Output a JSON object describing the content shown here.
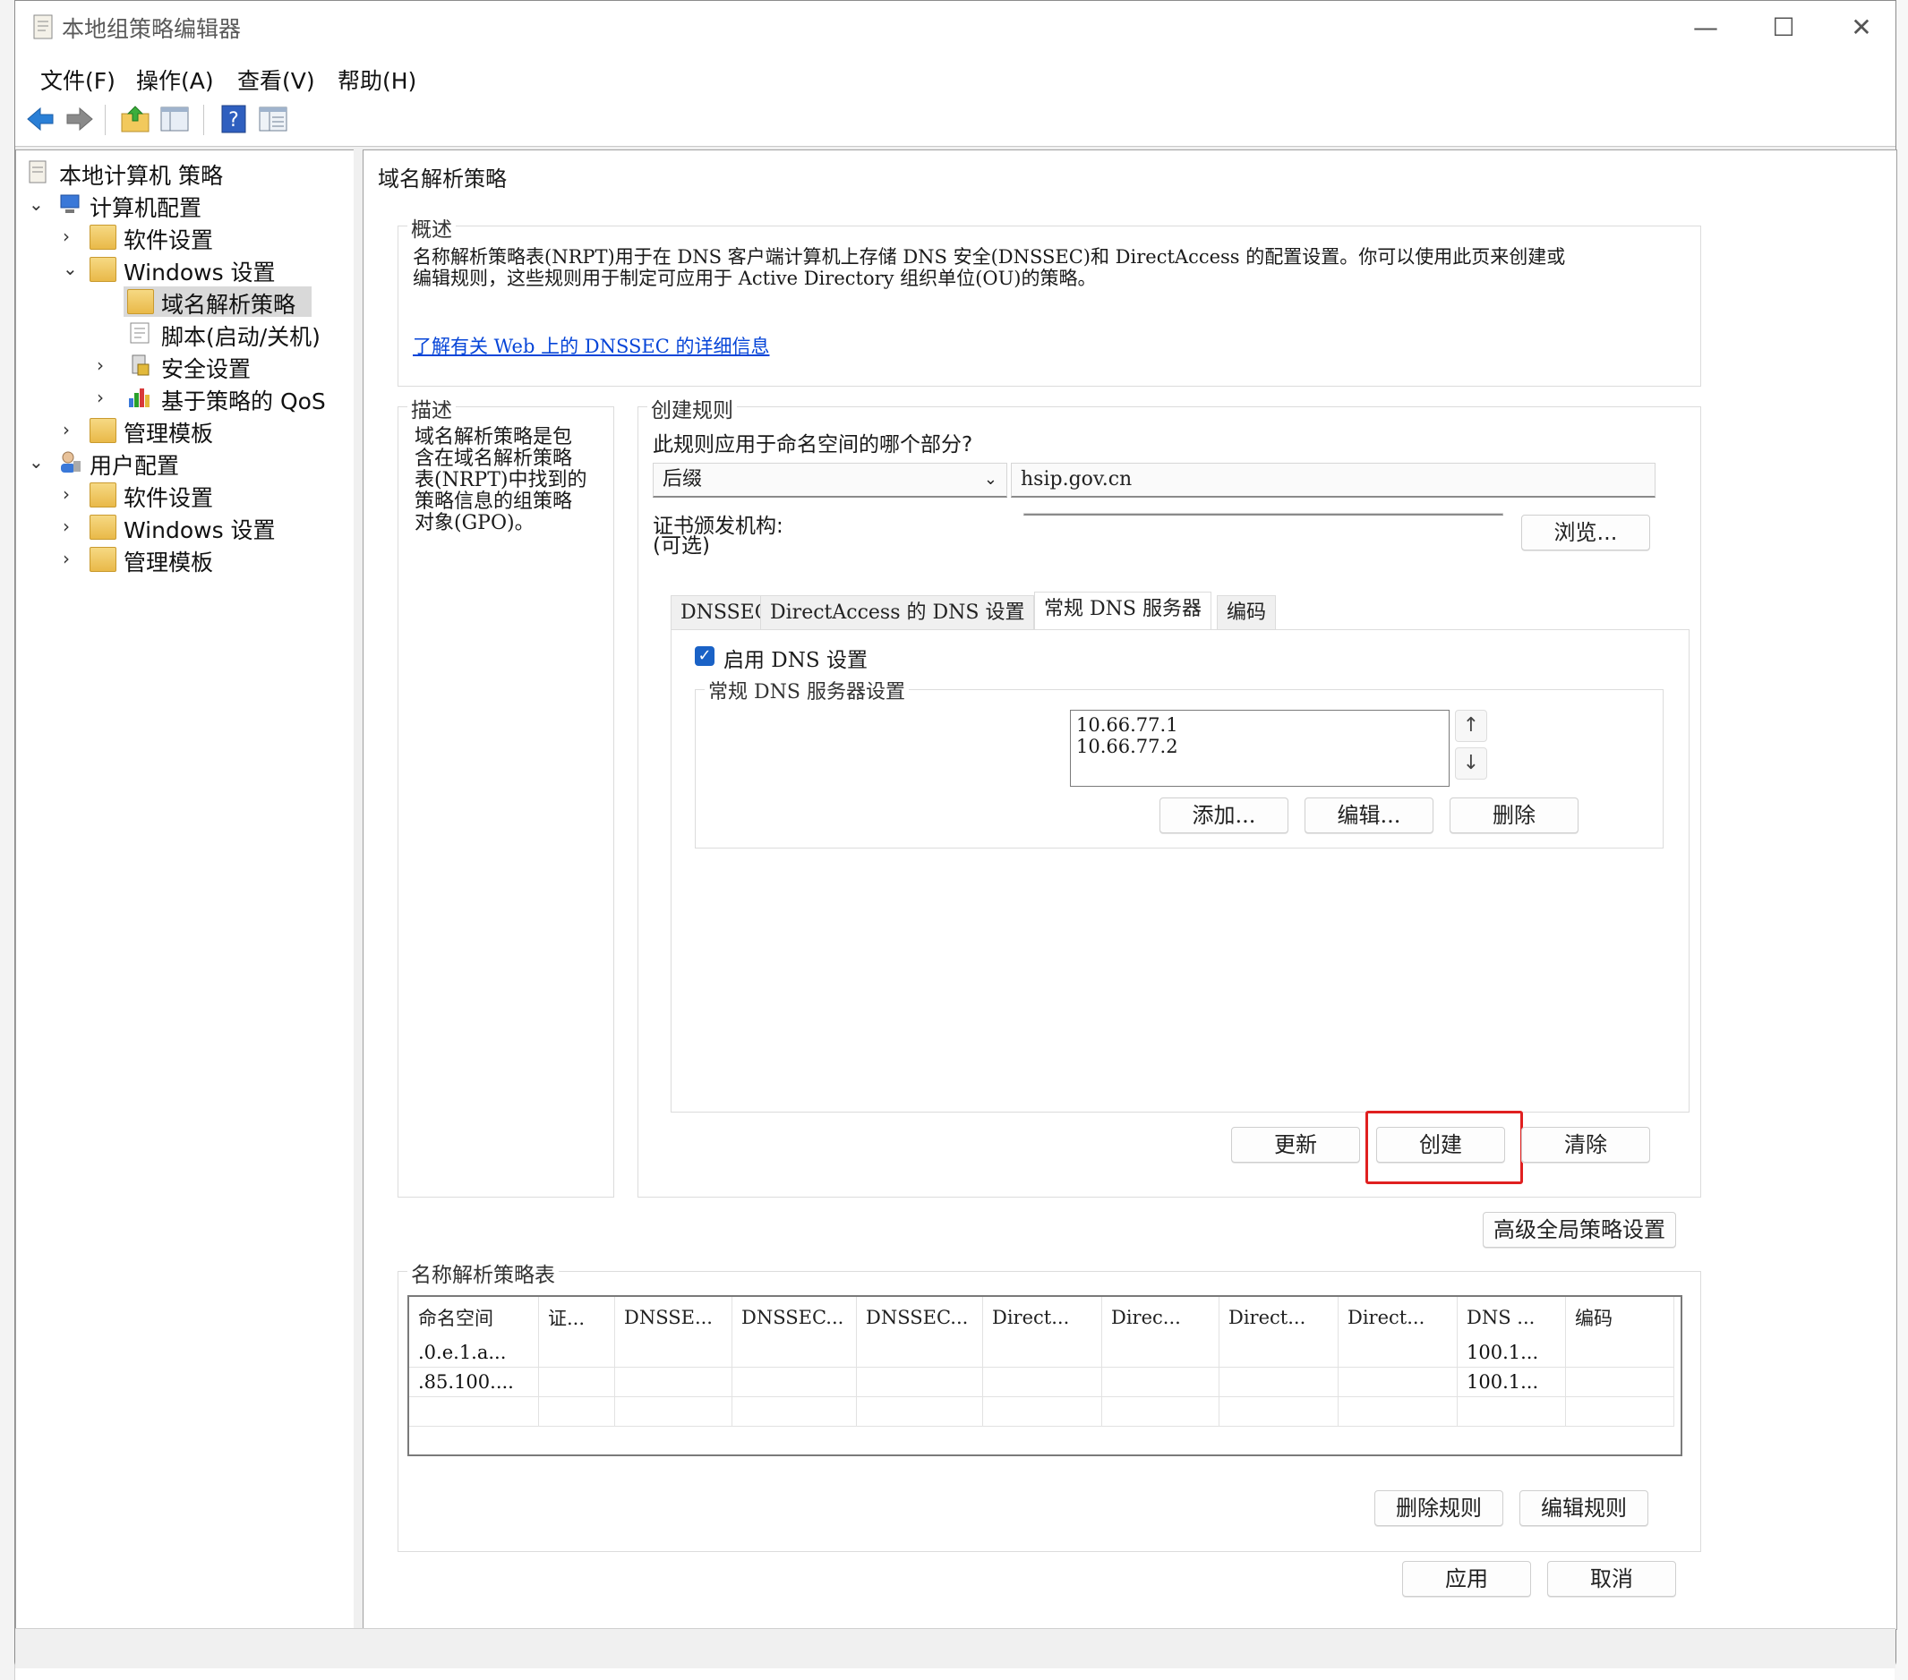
{
  "window": {
    "title": "本地组策略编辑器",
    "min_icon": "minimize-icon",
    "max_icon": "maximize-icon",
    "close_icon": "close-icon"
  },
  "menu": [
    "文件(F)",
    "操作(A)",
    "查看(V)",
    "帮助(H)"
  ],
  "toolbar": {
    "icons": [
      "back-arrow-icon",
      "forward-arrow-icon",
      "up-folder-icon",
      "show-hide-tree-icon",
      "help-icon",
      "properties-view-icon"
    ]
  },
  "tree": {
    "root": "本地计算机 策略",
    "computer": "计算机配置",
    "c_software": "软件设置",
    "c_windows": "Windows 设置",
    "nrp": "域名解析策略",
    "scripts": "脚本(启动/关机)",
    "security": "安全设置",
    "qos": "基于策略的 QoS",
    "c_admin": "管理模板",
    "user": "用户配置",
    "u_software": "软件设置",
    "u_windows": "Windows 设置",
    "u_admin": "管理模板"
  },
  "page": {
    "heading": "域名解析策略",
    "overview": {
      "legend": "概述",
      "line1": "名称解析策略表(NRPT)用于在 DNS 客户端计算机上存储 DNS 安全(DNSSEC)和 DirectAccess 的配置设置。你可以使用此页来创建或",
      "line2": "编辑规则，这些规则用于制定可应用于 Active Directory 组织单位(OU)的策略。",
      "link": "了解有关 Web 上的 DNSSEC 的详细信息"
    },
    "description": {
      "legend": "描述",
      "lines": [
        "域名解析策略是包",
        "含在域名解析策略",
        "表(NRPT)中找到的",
        "策略信息的组策略",
        "对象(GPO)。"
      ]
    },
    "create_rule": {
      "legend": "创建规则",
      "question": "此规则应用于命名空间的哪个部分?",
      "namespace_type": "后缀",
      "namespace_value": "hsip.gov.cn",
      "cert_label_1": "证书颁发机构:",
      "cert_label_2": "(可选)",
      "cert_value": "",
      "browse": "浏览...",
      "tabs": [
        "DNSSEC",
        "DirectAccess 的 DNS 设置",
        "常规 DNS 服务器",
        "编码"
      ],
      "enable_dns": "启用 DNS 设置",
      "enable_dns_checked": true,
      "dns_group": "常规 DNS 服务器设置",
      "dns_servers": [
        "10.66.77.1",
        "10.66.77.2"
      ],
      "add": "添加...",
      "edit": "编辑...",
      "delete": "删除",
      "update": "更新",
      "create": "创建",
      "clear": "清除"
    },
    "advanced_global": "高级全局策略设置",
    "nrpt_table": {
      "legend": "名称解析策略表",
      "columns": [
        "命名空间",
        "证...",
        "DNSSE...",
        "DNSSEC...",
        "DNSSEC...",
        "Direct...",
        "Direc...",
        "Direct...",
        "Direct...",
        "DNS ...",
        "编码"
      ],
      "rows": [
        [
          ".0.e.1.a...",
          "",
          "",
          "",
          "",
          "",
          "",
          "",
          "",
          "100.1...",
          ""
        ],
        [
          ".85.100....",
          "",
          "",
          "",
          "",
          "",
          "",
          "",
          "",
          "100.1...",
          ""
        ],
        [
          "",
          "",
          "",
          "",
          "",
          "",
          "",
          "",
          "",
          "",
          ""
        ]
      ]
    },
    "delete_rule": "删除规则",
    "edit_rule": "编辑规则",
    "apply": "应用",
    "cancel": "取消"
  },
  "colors": {
    "highlight_box": "#e02020",
    "link": "#0645d8",
    "checkbox": "#1a62c6",
    "tree_selected": "#d9d9d9"
  }
}
